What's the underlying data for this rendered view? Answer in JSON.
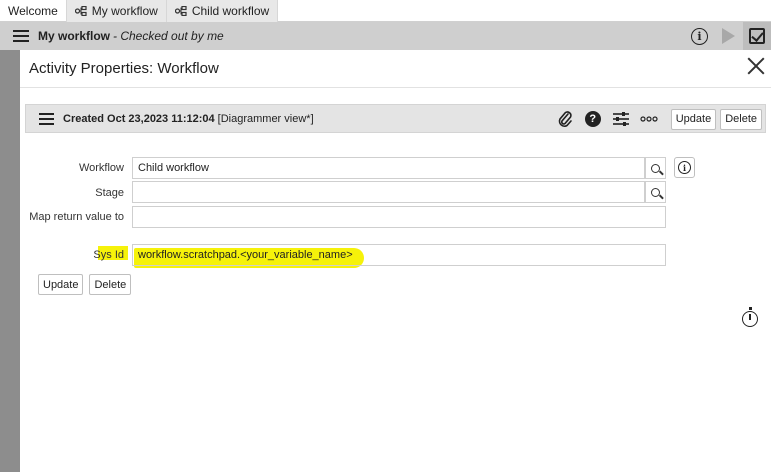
{
  "tabs": [
    {
      "label": "Welcome"
    },
    {
      "label": "My workflow",
      "icon": "workflow-icon"
    },
    {
      "label": "Child workflow",
      "icon": "workflow-icon"
    }
  ],
  "workflow_header": {
    "title": "My workflow",
    "subtitle": "- Checked out by me"
  },
  "modal": {
    "title": "Activity Properties: Workflow",
    "form_header": {
      "created": "Created Oct 23,2023 11:12:04",
      "view": "[Diagrammer view*]",
      "update_label": "Update",
      "delete_label": "Delete"
    },
    "fields": {
      "workflow_label": "Workflow",
      "workflow_value": "Child workflow",
      "stage_label": "Stage",
      "stage_value": "",
      "map_return_label": "Map return value to",
      "map_return_value": "",
      "sys_id_label": "Sys Id",
      "sys_id_value": "workflow.scratchpad.<your_variable_name>"
    },
    "bottom_buttons": {
      "update_label": "Update",
      "delete_label": "Delete"
    }
  },
  "colors": {
    "highlight": "#f6f20a",
    "header_bg": "#cfcfcf",
    "form_bar_bg": "#e4e4e4"
  }
}
